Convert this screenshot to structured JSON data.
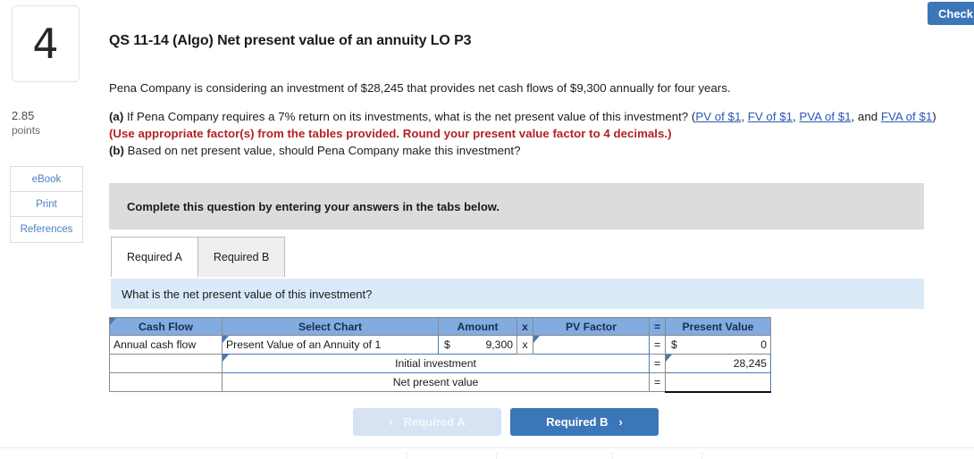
{
  "check_button": {
    "label": "Check"
  },
  "rail": {
    "question_number": "4",
    "points_value": "2.85",
    "points_label": "points",
    "buttons": [
      {
        "label": "eBook"
      },
      {
        "label": "Print"
      },
      {
        "label": "References"
      }
    ]
  },
  "question": {
    "title": "QS 11-14 (Algo) Net present value of an annuity LO P3",
    "intro": "Pena Company is considering an investment of $28,245 that provides net cash flows of $9,300 annually for four years.",
    "part_a_label": "(a)",
    "part_a_text": " If Pena Company requires a 7% return on its investments, what is the net present value of this investment? (",
    "links": [
      {
        "label": "PV of $1"
      },
      {
        "label": "FV of $1"
      },
      {
        "label": "PVA of $1"
      },
      {
        "label": "FVA of $1"
      }
    ],
    "link_sep1": ", ",
    "link_sep2": ", ",
    "link_sep3": ", and ",
    "link_close": ") ",
    "red_note": "(Use appropriate factor(s) from the tables provided. Round your present value factor to 4 decimals.)",
    "part_b_label": "(b)",
    "part_b_text": " Based on net present value, should Pena Company make this investment?"
  },
  "instruction_band": {
    "text": "Complete this question by entering your answers in the tabs below."
  },
  "tabs": [
    {
      "label": "Required A",
      "active": true
    },
    {
      "label": "Required B",
      "active": false
    }
  ],
  "question_strip": {
    "text": "What is the net present value of this investment?"
  },
  "table": {
    "headers": [
      "Cash Flow",
      "Select Chart",
      "Amount",
      "x",
      "PV Factor",
      "=",
      "Present Value"
    ],
    "rows": [
      {
        "cash_flow": "Annual cash flow",
        "select_chart": "Present Value of an Annuity of 1",
        "amount_currency": "$",
        "amount_value": "9,300",
        "operator_x": "x",
        "pv_factor": "",
        "operator_eq": "=",
        "pv_currency": "$",
        "pv_value": "0"
      },
      {
        "cash_flow": "",
        "label": "Initial investment",
        "operator_eq": "=",
        "pv_value": "28,245"
      },
      {
        "cash_flow": "",
        "label": "Net present value",
        "operator_eq": "=",
        "pv_value": ""
      }
    ]
  },
  "nav": {
    "prev_label": "Required A",
    "prev_chevron": "‹",
    "next_label": "Required B",
    "next_chevron": "›"
  },
  "colors": {
    "table_header_blue": "#82abe0",
    "instruction_gray": "#dcdcdc",
    "question_strip_blue": "#daeaf8",
    "primary_blue": "#3b76b8",
    "muted_blue": "#d7e3f2",
    "answer_yellow": "#fcf7c4",
    "link_blue": "#2b57b5",
    "alert_red": "#b32222"
  }
}
